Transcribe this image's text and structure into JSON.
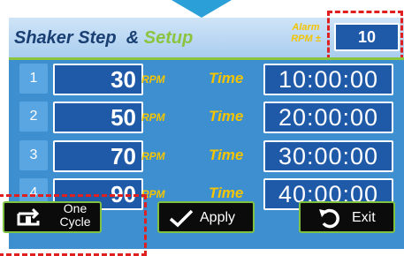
{
  "header": {
    "title": "Shaker Step",
    "title_amp": "&",
    "title_setup": "Setup",
    "alarm_label_line1": "Alarm",
    "alarm_label_line2": "RPM ±",
    "alarm_value": "10"
  },
  "steps": [
    {
      "num": "1",
      "rpm": "30",
      "rpm_unit": "RPM",
      "time_label": "Time",
      "time": "10:00:00"
    },
    {
      "num": "2",
      "rpm": "50",
      "rpm_unit": "RPM",
      "time_label": "Time",
      "time": "20:00:00"
    },
    {
      "num": "3",
      "rpm": "70",
      "rpm_unit": "RPM",
      "time_label": "Time",
      "time": "30:00:00"
    },
    {
      "num": "4",
      "rpm": "90",
      "rpm_unit": "RPM",
      "time_label": "Time",
      "time": "40:00:00"
    }
  ],
  "buttons": {
    "one_cycle_line1": "One",
    "one_cycle_line2": "Cycle",
    "apply": "Apply",
    "exit": "Exit"
  },
  "colors": {
    "panel": "#3d8fd0",
    "field": "#1f5aa8",
    "label_yellow": "#f4c400",
    "accent_green": "#8bc53f",
    "highlight_red": "#e02020"
  },
  "icons": {
    "one_cycle": "repeat-once-icon",
    "apply": "checkmark-icon",
    "exit": "undo-arrow-icon"
  }
}
